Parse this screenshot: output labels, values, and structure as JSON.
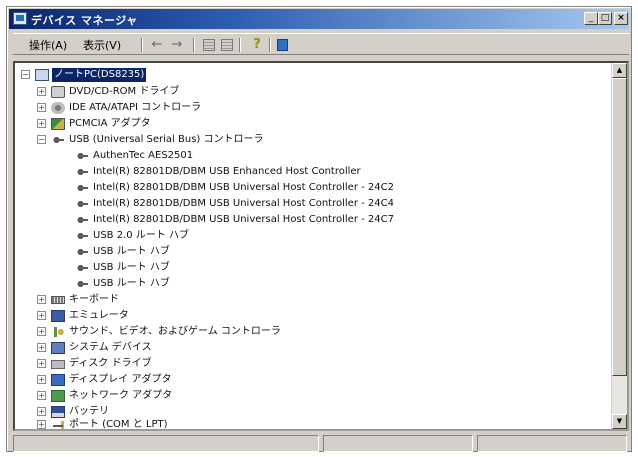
{
  "window": {
    "title": "デバイス マネージャ",
    "minimize_glyph": "_",
    "maximize_glyph": "□",
    "close_glyph": "×",
    "app_icon": "device-manager-icon"
  },
  "menubar": {
    "items": [
      {
        "label": "操作(A)"
      },
      {
        "label": "表示(V)"
      }
    ],
    "toolbar": {
      "back_glyph": "←",
      "forward_glyph": "→",
      "icons": [
        "properties-grid-icon",
        "view-list-icon",
        "help-icon",
        "refresh-icon"
      ],
      "help_glyph": "?"
    }
  },
  "tree": {
    "root": {
      "label": "ノートPC(DS8235)",
      "expanded_glyph": "−",
      "icon": "computer-icon"
    },
    "nodes": [
      {
        "label": "DVD/CD-ROM ドライブ",
        "icon": "dvd-drive-icon",
        "glyph": "+"
      },
      {
        "label": "IDE ATA/ATAPI コントローラ",
        "icon": "ide-controller-icon",
        "glyph": "+"
      },
      {
        "label": "PCMCIA アダプタ",
        "icon": "pcmcia-icon",
        "glyph": "+"
      },
      {
        "label": "USB (Universal Serial Bus) コントローラ",
        "icon": "usb-icon",
        "glyph": "−"
      },
      {
        "label": "AuthenTec AES2501",
        "icon": "usb-device-icon"
      },
      {
        "label": "Intel(R) 82801DB/DBM USB Enhanced Host Controller",
        "icon": "usb-device-icon"
      },
      {
        "label": "Intel(R) 82801DB/DBM USB Universal Host Controller - 24C2",
        "icon": "usb-device-icon"
      },
      {
        "label": "Intel(R) 82801DB/DBM USB Universal Host Controller - 24C4",
        "icon": "usb-device-icon"
      },
      {
        "label": "Intel(R) 82801DB/DBM USB Universal Host Controller - 24C7",
        "icon": "usb-device-icon"
      },
      {
        "label": "USB 2.0 ルート ハブ",
        "icon": "usb-device-icon"
      },
      {
        "label": "USB ルート ハブ",
        "icon": "usb-device-icon"
      },
      {
        "label": "USB ルート ハブ",
        "icon": "usb-device-icon"
      },
      {
        "label": "USB ルート ハブ",
        "icon": "usb-device-icon"
      },
      {
        "label": "キーボード",
        "icon": "keyboard-icon",
        "glyph": "+"
      },
      {
        "label": "エミュレータ",
        "icon": "emulator-icon",
        "glyph": "+"
      },
      {
        "label": "サウンド、ビデオ、およびゲーム コントローラ",
        "icon": "sound-video-icon",
        "glyph": "+"
      },
      {
        "label": "システム デバイス",
        "icon": "system-device-icon",
        "glyph": "+"
      },
      {
        "label": "ディスク ドライブ",
        "icon": "disk-drive-icon",
        "glyph": "+"
      },
      {
        "label": "ディスプレイ アダプタ",
        "icon": "display-adapter-icon",
        "glyph": "+"
      },
      {
        "label": "ネットワーク アダプタ",
        "icon": "network-adapter-icon",
        "glyph": "+"
      },
      {
        "label": "バッテリ",
        "icon": "battery-icon",
        "glyph": "+"
      },
      {
        "label": "ポート (COM と LPT)",
        "icon": "port-icon",
        "glyph": "+"
      }
    ]
  },
  "scrollbar": {
    "up_glyph": "▲",
    "down_glyph": "▼"
  },
  "colors": {
    "title_active": "#0a246a",
    "selection": "#0a246a",
    "chrome": "#d4d0c8"
  }
}
